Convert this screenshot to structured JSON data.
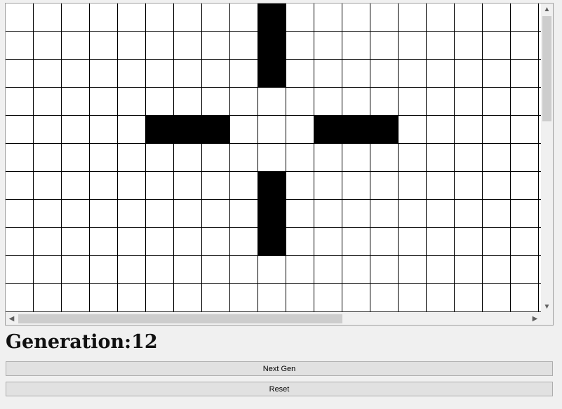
{
  "grid": {
    "rows": 11,
    "cols": 20,
    "alive_cells": [
      [
        0,
        9
      ],
      [
        1,
        9
      ],
      [
        2,
        9
      ],
      [
        4,
        5
      ],
      [
        4,
        6
      ],
      [
        4,
        7
      ],
      [
        4,
        11
      ],
      [
        4,
        12
      ],
      [
        4,
        13
      ],
      [
        6,
        9
      ],
      [
        7,
        9
      ],
      [
        8,
        9
      ]
    ]
  },
  "status": {
    "generation_label": "Generation:",
    "generation_value": "12"
  },
  "buttons": {
    "next_gen": "Next Gen",
    "reset": "Reset"
  },
  "icons": {
    "scroll_up": "chevron-up-icon",
    "scroll_down": "chevron-down-icon",
    "scroll_left": "chevron-left-icon",
    "scroll_right": "chevron-right-icon"
  }
}
